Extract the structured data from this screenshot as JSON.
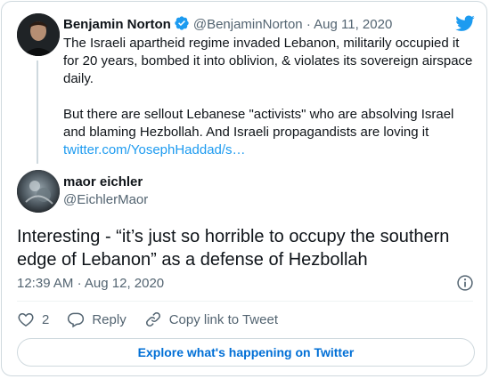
{
  "parent_tweet": {
    "author_name": "Benjamin Norton",
    "author_handle": "@BenjaminNorton",
    "separator": "·",
    "date": "Aug 11, 2020",
    "paragraph_1": "The Israeli apartheid regime invaded Lebanon, militarily occupied it for 20 years, bombed it into oblivion, & violates its sovereign airspace daily.",
    "paragraph_2": "But there are sellout Lebanese \"activists\" who are absolving Israel and blaming Hezbollah. And Israeli propagandists are loving it",
    "link_text": "twitter.com/YosephHaddad/s…",
    "icons": [
      "verified-badge-icon",
      "twitter-bird-icon"
    ]
  },
  "reply_tweet": {
    "author_name": "maor eichler",
    "author_handle": "@EichlerMaor",
    "text": "Interesting - “it’s just so horrible to occupy the southern edge of Lebanon” as a defense of Hezbollah",
    "time": "12:39 AM",
    "separator": "·",
    "date": "Aug 12, 2020"
  },
  "actions": {
    "like_count": "2",
    "reply_label": "Reply",
    "copy_link_label": "Copy link to Tweet"
  },
  "explore_label": "Explore what's happening on Twitter",
  "colors": {
    "accent": "#1d9bf0",
    "muted": "#536471",
    "border": "#cfd9de",
    "explore_text": "#006fd6"
  }
}
